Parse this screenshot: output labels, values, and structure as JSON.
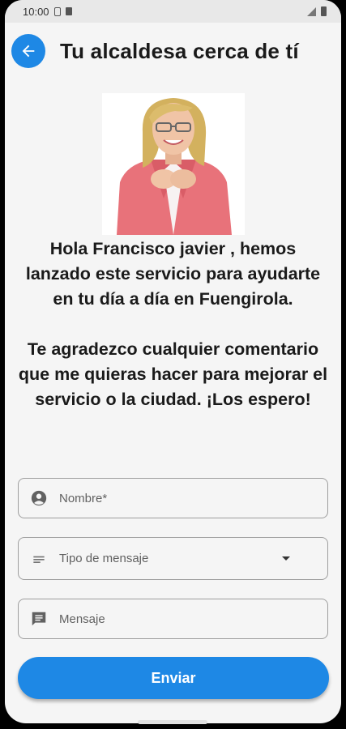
{
  "status_bar": {
    "time": "10:00"
  },
  "header": {
    "title": "Tu alcaldesa cerca de tí"
  },
  "intro": {
    "paragraph1": "Hola Francisco javier , hemos lanzado este servicio para ayudarte en tu día a día en Fuengirola.",
    "paragraph2": "Te agradezco cualquier comentario que me quieras hacer para mejorar el servicio o la ciudad. ¡Los espero!"
  },
  "form": {
    "name_placeholder": "Nombre*",
    "type_placeholder": "Tipo de mensaje",
    "message_placeholder": "Mensaje",
    "submit_label": "Enviar"
  },
  "colors": {
    "accent": "#1e88e5",
    "background": "#f5f5f5"
  }
}
